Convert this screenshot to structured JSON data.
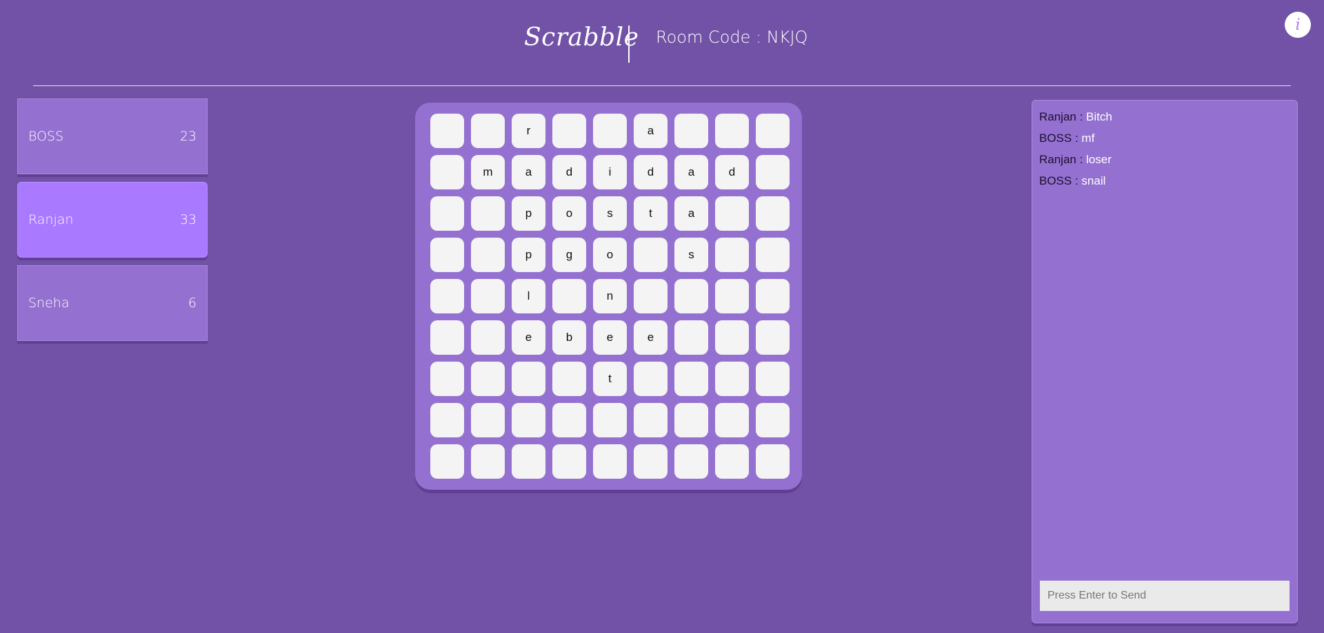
{
  "header": {
    "logo": "Scrabble",
    "room_code": "Room Code : NKJQ",
    "info_label": "i"
  },
  "players": [
    {
      "name": "BOSS",
      "score": "23",
      "active": false
    },
    {
      "name": "Ranjan",
      "score": "33",
      "active": true
    },
    {
      "name": "Sneha",
      "score": "6",
      "active": false
    }
  ],
  "board": {
    "rows": [
      [
        "",
        "",
        "r",
        "",
        "",
        "a",
        "",
        "",
        ""
      ],
      [
        "",
        "m",
        "a",
        "d",
        "i",
        "d",
        "a",
        "d",
        ""
      ],
      [
        "",
        "",
        "p",
        "o",
        "s",
        "t",
        "a",
        "",
        ""
      ],
      [
        "",
        "",
        "p",
        "g",
        "o",
        "",
        "s",
        "",
        ""
      ],
      [
        "",
        "",
        "l",
        "",
        "n",
        "",
        "",
        "",
        ""
      ],
      [
        "",
        "",
        "e",
        "b",
        "e",
        "e",
        "",
        "",
        ""
      ],
      [
        "",
        "",
        "",
        "",
        "t",
        "",
        "",
        "",
        ""
      ],
      [
        "",
        "",
        "",
        "",
        "",
        "",
        "",
        "",
        ""
      ],
      [
        "",
        "",
        "",
        "",
        "",
        "",
        "",
        "",
        ""
      ]
    ]
  },
  "chat": {
    "messages": [
      {
        "sender": "Ranjan",
        "text": "Bitch"
      },
      {
        "sender": "BOSS",
        "text": "mf"
      },
      {
        "sender": "Ranjan",
        "text": "loser"
      },
      {
        "sender": "BOSS",
        "text": "snail"
      }
    ],
    "placeholder": "Press Enter to Send"
  }
}
